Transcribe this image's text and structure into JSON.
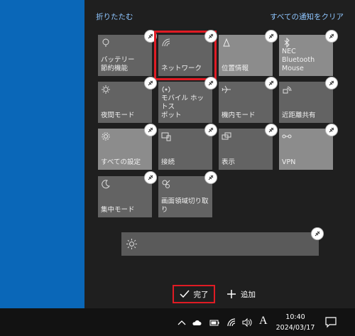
{
  "action_center": {
    "collapse_label": "折りたたむ",
    "clear_all_label": "すべての通知をクリア",
    "tiles": [
      {
        "label": "バッテリー\n節約機能",
        "icon": "battery-saver-icon"
      },
      {
        "label": "ネットワーク",
        "icon": "network-icon"
      },
      {
        "label": "位置情報",
        "icon": "location-icon"
      },
      {
        "label": "NEC Bluetooth\nMouse",
        "icon": "bluetooth-icon"
      },
      {
        "label": "夜間モード",
        "icon": "night-light-icon"
      },
      {
        "label": "モバイル ホットス\nポット",
        "icon": "mobile-hotspot-icon"
      },
      {
        "label": "機内モード",
        "icon": "airplane-icon"
      },
      {
        "label": "近距離共有",
        "icon": "nearby-share-icon"
      },
      {
        "label": "すべての設定",
        "icon": "settings-gear-icon"
      },
      {
        "label": "接続",
        "icon": "connect-icon"
      },
      {
        "label": "表示",
        "icon": "project-icon"
      },
      {
        "label": "VPN",
        "icon": "vpn-icon"
      },
      {
        "label": "集中モード",
        "icon": "focus-assist-icon"
      },
      {
        "label": "画面領域切り取\nり",
        "icon": "screen-snip-icon"
      }
    ],
    "done_label": "完了",
    "add_label": "追加"
  },
  "taskbar": {
    "ime_label": "A",
    "time": "10:40",
    "date": "2024/03/17"
  },
  "colors": {
    "desktop": "#0a67b8",
    "panel": "#1f1f1f",
    "link": "#8fc6ff",
    "highlight": "#e01b24"
  }
}
